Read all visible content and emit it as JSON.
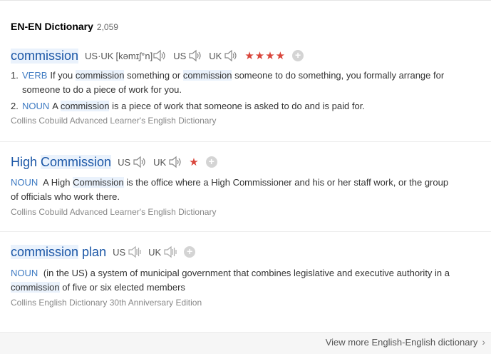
{
  "header": {
    "title": "EN-EN Dictionary",
    "count": "2,059"
  },
  "entries": [
    {
      "headword": "commission",
      "pron_usuk_label": "US·UK",
      "ipa": "[kəmɪʃ°n]",
      "pron_us_label": "US",
      "pron_uk_label": "UK",
      "rating": "★★★★",
      "defs": [
        {
          "num": "1.",
          "pos": "VERB",
          "t1": "If you ",
          "h1": "commission",
          "t2": " something or ",
          "h2": "commission",
          "t3": " someone to do something, you formally arrange for",
          "t4": "someone to do a piece of work for you."
        },
        {
          "num": "2.",
          "pos": "NOUN",
          "t1": "A ",
          "h1": "commission",
          "t2": " is a piece of work that someone is asked to do and is paid for."
        }
      ],
      "source": "Collins Cobuild Advanced Learner's English Dictionary"
    },
    {
      "headword_a": "High",
      "headword_b": "Commission",
      "pron_us_label": "US",
      "pron_uk_label": "UK",
      "rating": "★",
      "pos": "NOUN",
      "t1": " A High ",
      "h1": "Commission",
      "t2": " is the office where a High Commissioner and his or her staff work, or the group",
      "t3": "of officials who work there.",
      "source": "Collins Cobuild Advanced Learner's English Dictionary"
    },
    {
      "headword_a": "commission",
      "headword_b": "plan",
      "pron_us_label": "US",
      "pron_uk_label": "UK",
      "pos": "NOUN",
      "t1": " (in the US) a system of municipal government that combines legislative and executive authority in a",
      "h1": "commission",
      "t2": " of five or six elected members",
      "source": "Collins English Dictionary 30th Anniversary Edition"
    }
  ],
  "footer": {
    "more_label": "View more English-English dictionary",
    "chevron": "›"
  },
  "icons": {
    "speaker": "speaker-icon",
    "add": "add-icon"
  },
  "colors": {
    "headword": "#1a56a6",
    "pos": "#3d7ac2",
    "star": "#d9453b",
    "highlight": "#eaf2fc"
  }
}
